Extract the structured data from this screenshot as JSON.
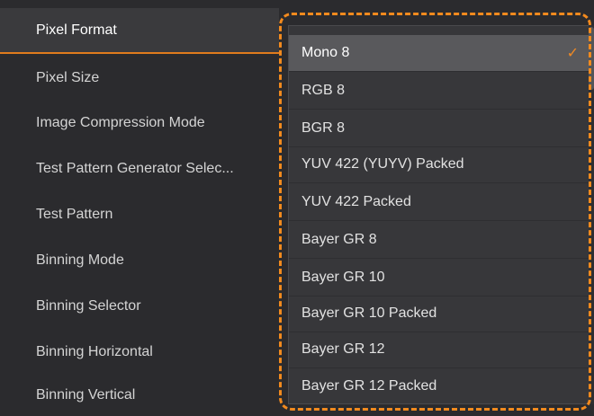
{
  "params": [
    "Pixel Format",
    "Pixel Size",
    "Image Compression Mode",
    "Test Pattern Generator Selec...",
    "Test Pattern",
    "Binning Mode",
    "Binning Selector",
    "Binning Horizontal",
    "Binning Vertical"
  ],
  "dropdown": {
    "options": [
      "Mono 8",
      "RGB 8",
      "BGR 8",
      "YUV 422 (YUYV) Packed",
      "YUV 422 Packed",
      "Bayer GR 8",
      "Bayer GR 10",
      "Bayer GR 10 Packed",
      "Bayer GR 12",
      "Bayer GR 12 Packed"
    ],
    "selected": "Mono 8",
    "check_glyph": "✓"
  },
  "colors": {
    "accent": "#f28a1e",
    "background": "#2b2b2e",
    "dropdown_bg": "#37373a",
    "selected_option_bg": "#59595c"
  }
}
